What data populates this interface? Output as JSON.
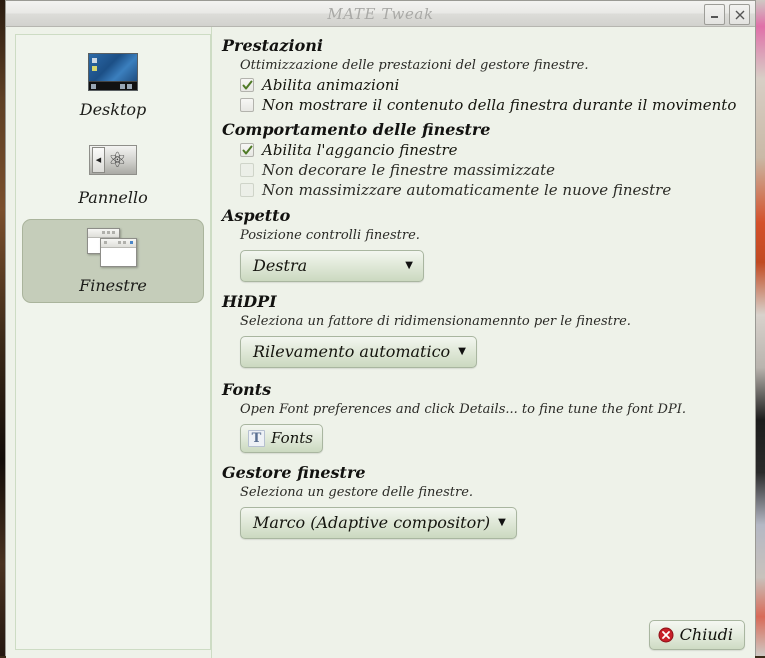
{
  "window": {
    "title": "MATE Tweak",
    "minimize_label": "Minimizza",
    "close_label": "Chiudi finestra"
  },
  "sidebar": {
    "items": [
      {
        "label": "Desktop",
        "icon": "desktop-thumbnail-icon",
        "selected": false
      },
      {
        "label": "Pannello",
        "icon": "panel-icon",
        "selected": false
      },
      {
        "label": "Finestre",
        "icon": "windows-stack-icon",
        "selected": true
      }
    ]
  },
  "sections": {
    "performance": {
      "heading": "Prestazioni",
      "description": "Ottimizzazione delle prestazioni del gestore finestre.",
      "checkboxes": [
        {
          "label": "Abilita animazioni",
          "checked": true,
          "disabled": false
        },
        {
          "label": "Non mostrare il contenuto della finestra durante il movimento",
          "checked": false,
          "disabled": false
        }
      ]
    },
    "behaviour": {
      "heading": "Comportamento delle finestre",
      "checkboxes": [
        {
          "label": "Abilita l'aggancio finestre",
          "checked": true,
          "disabled": false
        },
        {
          "label": "Non decorare le finestre massimizzate",
          "checked": false,
          "disabled": true
        },
        {
          "label": "Non massimizzare automaticamente le nuove finestre",
          "checked": false,
          "disabled": true
        }
      ]
    },
    "appearance": {
      "heading": "Aspetto",
      "description": "Posizione controlli finestre.",
      "dropdown": {
        "value": "Destra",
        "arrow": "chevron-down-icon"
      }
    },
    "hidpi": {
      "heading": "HiDPI",
      "description": "Seleziona un fattore di ridimensionamennto per le finestre.",
      "dropdown": {
        "value": "Rilevamento automatico",
        "arrow": "chevron-down-icon"
      }
    },
    "fonts": {
      "heading": "Fonts",
      "description": "Open Font preferences and click Details... to fine tune the font DPI.",
      "button": {
        "label": "Fonts",
        "icon": "font-t-icon"
      }
    },
    "window_manager": {
      "heading": "Gestore finestre",
      "description": "Seleziona un gestore delle finestre.",
      "dropdown": {
        "value": "Marco (Adaptive compositor)",
        "arrow": "chevron-down-icon"
      }
    }
  },
  "footer": {
    "close_label": "Chiudi",
    "close_icon": "error-circle-x-icon"
  },
  "colors": {
    "window_background": "#eef2e9",
    "sidebar_background": "#f0f4ec",
    "selected_item": "#c5cdba",
    "titlebar_text": "#a9a9a6",
    "button_accent": "#cbd9c0",
    "close_icon_red": "#c8202a",
    "cursor_red": "#e8262b",
    "checkmark_green": "#4f7a26"
  }
}
